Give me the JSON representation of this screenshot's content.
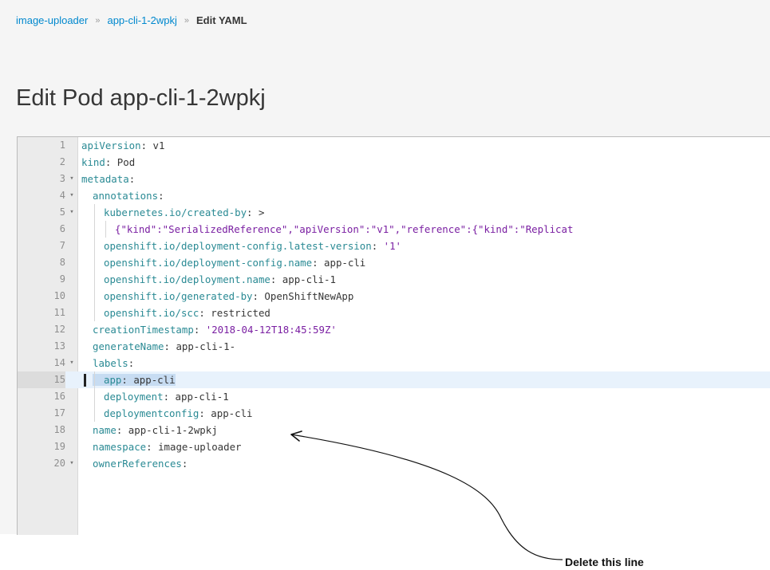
{
  "breadcrumb": {
    "project": "image-uploader",
    "pod": "app-cli-1-2wpkj",
    "current": "Edit YAML"
  },
  "page": {
    "title": "Edit Pod app-cli-1-2wpkj"
  },
  "editor": {
    "active_line": 15,
    "lines": [
      {
        "n": "1",
        "fold": "",
        "indent": 0,
        "k": "apiVersion",
        "v": " v1",
        "vs": ""
      },
      {
        "n": "2",
        "fold": "",
        "indent": 0,
        "k": "kind",
        "v": " Pod",
        "vs": ""
      },
      {
        "n": "3",
        "fold": "▾",
        "indent": 0,
        "k": "metadata",
        "v": "",
        "vs": ""
      },
      {
        "n": "4",
        "fold": "▾",
        "indent": 1,
        "k": "annotations",
        "v": "",
        "vs": ""
      },
      {
        "n": "5",
        "fold": "▾",
        "indent": 2,
        "k": "kubernetes.io/created-by",
        "v": " >",
        "vs": ""
      },
      {
        "n": "6",
        "fold": "",
        "indent": 3,
        "raw": "{\"kind\":\"SerializedReference\",\"apiVersion\":\"v1\",\"reference\":{\"kind\":\"Replicat"
      },
      {
        "n": "7",
        "fold": "",
        "indent": 2,
        "k": "openshift.io/deployment-config.latest-version",
        "v": " ",
        "vs": "'1'"
      },
      {
        "n": "8",
        "fold": "",
        "indent": 2,
        "k": "openshift.io/deployment-config.name",
        "v": " app-cli",
        "vs": ""
      },
      {
        "n": "9",
        "fold": "",
        "indent": 2,
        "k": "openshift.io/deployment.name",
        "v": " app-cli-1",
        "vs": ""
      },
      {
        "n": "10",
        "fold": "",
        "indent": 2,
        "k": "openshift.io/generated-by",
        "v": " OpenShiftNewApp",
        "vs": ""
      },
      {
        "n": "11",
        "fold": "",
        "indent": 2,
        "k": "openshift.io/scc",
        "v": " restricted",
        "vs": ""
      },
      {
        "n": "12",
        "fold": "",
        "indent": 1,
        "k": "creationTimestamp",
        "v": " ",
        "vs": "'2018-04-12T18:45:59Z'"
      },
      {
        "n": "13",
        "fold": "",
        "indent": 1,
        "k": "generateName",
        "v": " app-cli-1-",
        "vs": ""
      },
      {
        "n": "14",
        "fold": "▾",
        "indent": 1,
        "k": "labels",
        "v": "",
        "vs": ""
      },
      {
        "n": "15",
        "fold": "",
        "indent": 2,
        "k": "app",
        "v": " app-cli",
        "vs": "",
        "selected": true
      },
      {
        "n": "16",
        "fold": "",
        "indent": 2,
        "k": "deployment",
        "v": " app-cli-1",
        "vs": ""
      },
      {
        "n": "17",
        "fold": "",
        "indent": 2,
        "k": "deploymentconfig",
        "v": " app-cli",
        "vs": ""
      },
      {
        "n": "18",
        "fold": "",
        "indent": 1,
        "k": "name",
        "v": " app-cli-1-2wpkj",
        "vs": ""
      },
      {
        "n": "19",
        "fold": "",
        "indent": 1,
        "k": "namespace",
        "v": " image-uploader",
        "vs": ""
      },
      {
        "n": "20",
        "fold": "▾",
        "indent": 1,
        "k": "ownerReferences",
        "v": "",
        "vs": ""
      }
    ]
  },
  "annotation": {
    "text": "Delete this line"
  }
}
